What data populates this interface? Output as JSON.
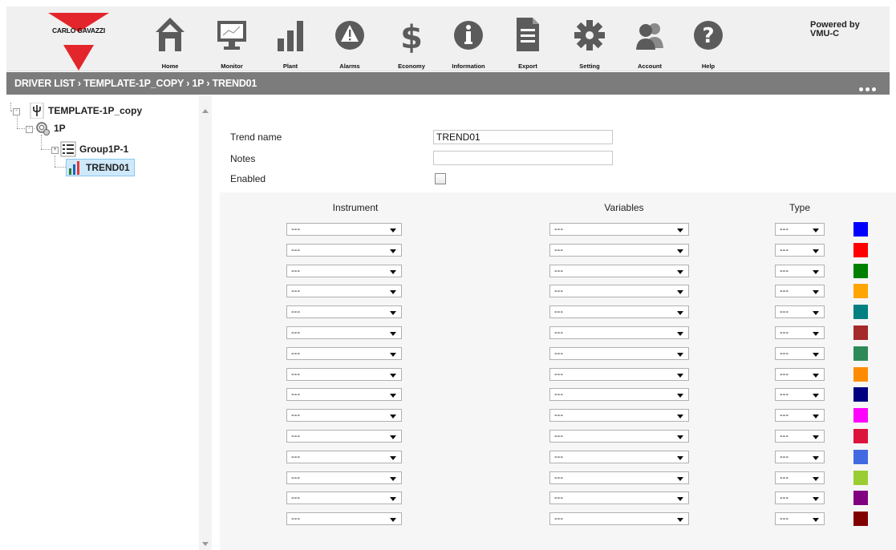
{
  "header": {
    "logo_text": "CARLO GAVAZZI",
    "nav": [
      {
        "label": "Home",
        "icon": "home-icon"
      },
      {
        "label": "Monitor",
        "icon": "monitor-icon"
      },
      {
        "label": "Plant",
        "icon": "plant-icon"
      },
      {
        "label": "Alarms",
        "icon": "alarm-icon"
      },
      {
        "label": "Economy",
        "icon": "dollar-icon"
      },
      {
        "label": "Information",
        "icon": "info-icon"
      },
      {
        "label": "Export",
        "icon": "export-icon"
      },
      {
        "label": "Setting",
        "icon": "gear-icon"
      },
      {
        "label": "Account",
        "icon": "account-icon"
      },
      {
        "label": "Help",
        "icon": "help-icon"
      }
    ],
    "powered_line1": "Powered by",
    "powered_line2": "VMU-C"
  },
  "breadcrumb": "DRIVER LIST › TEMPLATE-1P_COPY › 1P › TREND01",
  "tree": {
    "root": "TEMPLATE-1P_copy",
    "device": "1P",
    "group": "Group1P-1",
    "trend": "TREND01"
  },
  "form": {
    "trend_name_label": "Trend name",
    "trend_name_value": "TREND01",
    "notes_label": "Notes",
    "notes_value": "",
    "enabled_label": "Enabled",
    "enabled": false
  },
  "grid": {
    "headers": {
      "instrument": "Instrument",
      "variables": "Variables",
      "type": "Type"
    },
    "placeholder": "---",
    "colors": [
      "#0000ff",
      "#ff0000",
      "#008000",
      "#ffa500",
      "#008080",
      "#a52a2a",
      "#2e8b57",
      "#ff8c00",
      "#000080",
      "#ff00ff",
      "#dc143c",
      "#4169e1",
      "#9acd32",
      "#800080",
      "#800000"
    ]
  }
}
